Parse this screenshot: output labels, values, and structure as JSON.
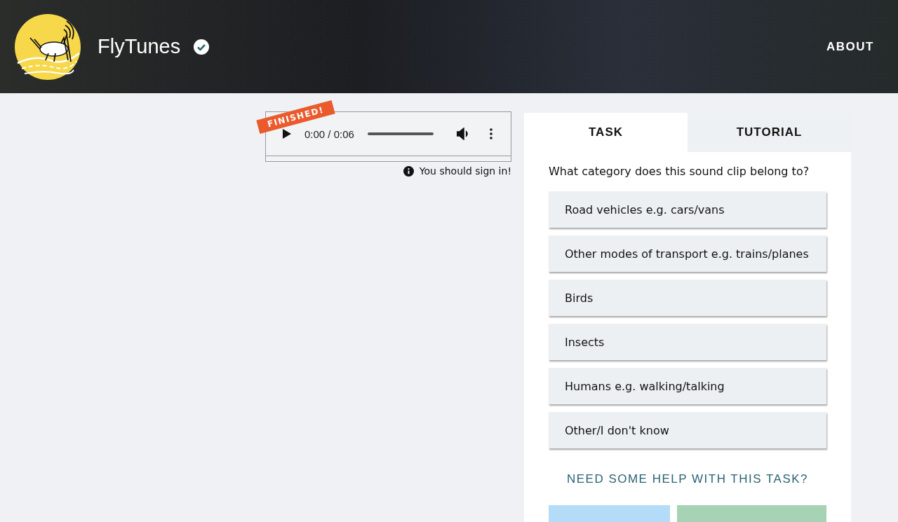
{
  "header": {
    "site_name": "FlyTunes",
    "verified": true,
    "nav": [
      "ABOUT"
    ]
  },
  "player": {
    "badge": "FINISHED!",
    "time": "0:00 / 0:06",
    "notice": "You should sign in!"
  },
  "tabs": [
    {
      "label": "TASK",
      "selected": true
    },
    {
      "label": "TUTORIAL",
      "selected": false
    }
  ],
  "question": "What category does this sound clip belong to?",
  "answers": [
    {
      "label": "Road vehicles e.g. cars/vans"
    },
    {
      "label": "Other modes of transport e.g. trains/planes"
    },
    {
      "label": "Birds"
    },
    {
      "label": "Insects"
    },
    {
      "label": "Humans e.g. walking/talking"
    },
    {
      "label": "Other/I don't know"
    }
  ],
  "help_link": "NEED SOME HELP WITH THIS TASK?"
}
